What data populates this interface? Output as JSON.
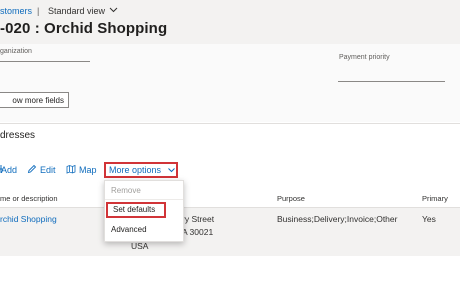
{
  "breadcrumb": {
    "link": "stomers",
    "separator": "|",
    "view": "Standard view",
    "chevron": "⌵"
  },
  "page_title": "-020 : Orchid Shopping",
  "fields": {
    "organization_label": "ganization",
    "payment_priority_label": "Payment priority"
  },
  "show_more_label": "ow more fields",
  "section_title": "dresses",
  "toolbar": {
    "add": "Add",
    "edit": "Edit",
    "map": "Map",
    "more_options": "More options"
  },
  "menu": {
    "remove": "Remove",
    "set_defaults": "Set defaults",
    "advanced": "Advanced"
  },
  "table": {
    "headers": {
      "name": "me or description",
      "purpose": "Purpose",
      "primary": "Primary"
    },
    "row": {
      "name": "rchid Shopping",
      "address_line1": "ry Street",
      "address_line2": "A 30021",
      "address_line3": "USA",
      "purpose": "Business;Delivery;Invoice;Other",
      "primary": "Yes"
    }
  },
  "colors": {
    "accent": "#0f6cbd",
    "highlight": "#d13438"
  },
  "icons": [
    "plus-icon",
    "edit-pencil-icon",
    "map-icon",
    "chevron-down-icon"
  ]
}
